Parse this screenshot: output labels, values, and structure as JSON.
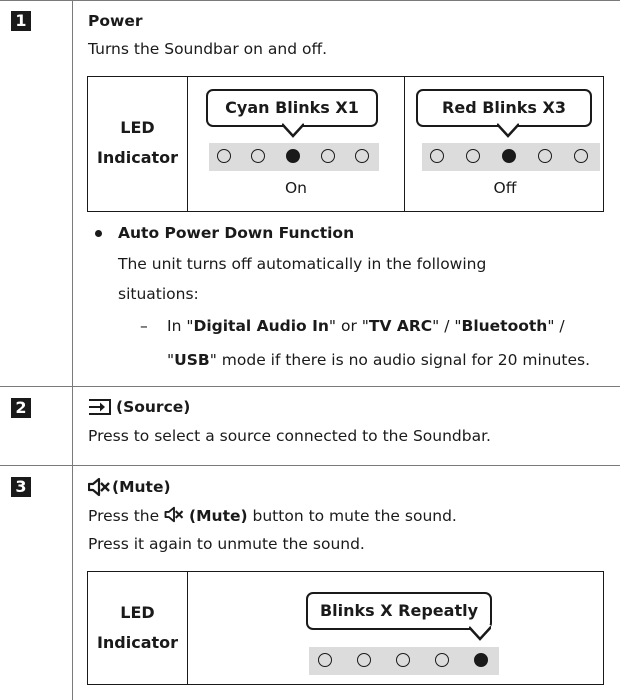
{
  "section1": {
    "number": "1",
    "title": "Power",
    "description": "Turns the Soundbar on and off.",
    "led_table": {
      "label_line1": "LED",
      "label_line2": "Indicator",
      "cells": [
        {
          "bubble": "Cyan Blinks X1",
          "leds": [
            false,
            false,
            true,
            false,
            false
          ],
          "state": "On"
        },
        {
          "bubble": "Red Blinks X3",
          "leds": [
            false,
            false,
            true,
            false,
            false
          ],
          "state": "Off"
        }
      ]
    },
    "bullet": {
      "title": "Auto Power Down Function",
      "text_line1": "The unit turns off automatically in the following",
      "text_line2": "situations:",
      "sub": {
        "dash": "–",
        "p1": "In \"",
        "b1": "Digital Audio In",
        "p2": "\" or \"",
        "b2": "TV ARC",
        "p3": "\" / \"",
        "b3": "Bluetooth",
        "p4": "\" /",
        "p5": "\"",
        "b4": "USB",
        "p6": "\" mode if there is no audio signal for 20 minutes."
      }
    }
  },
  "section2": {
    "number": "2",
    "title": "(Source)",
    "description": "Press to select a source connected to the Soundbar.",
    "icon": "source-icon"
  },
  "section3": {
    "number": "3",
    "title": "(Mute)",
    "line1_pre": "Press the ",
    "line1_bold": "(Mute)",
    "line1_post": " button to mute the sound.",
    "line2": "Press it again to unmute the sound.",
    "icon": "mute-icon",
    "led_table": {
      "label_line1": "LED",
      "label_line2": "Indicator",
      "bubble": "Blinks X Repeatly",
      "leds": [
        false,
        false,
        false,
        false,
        true
      ]
    }
  }
}
